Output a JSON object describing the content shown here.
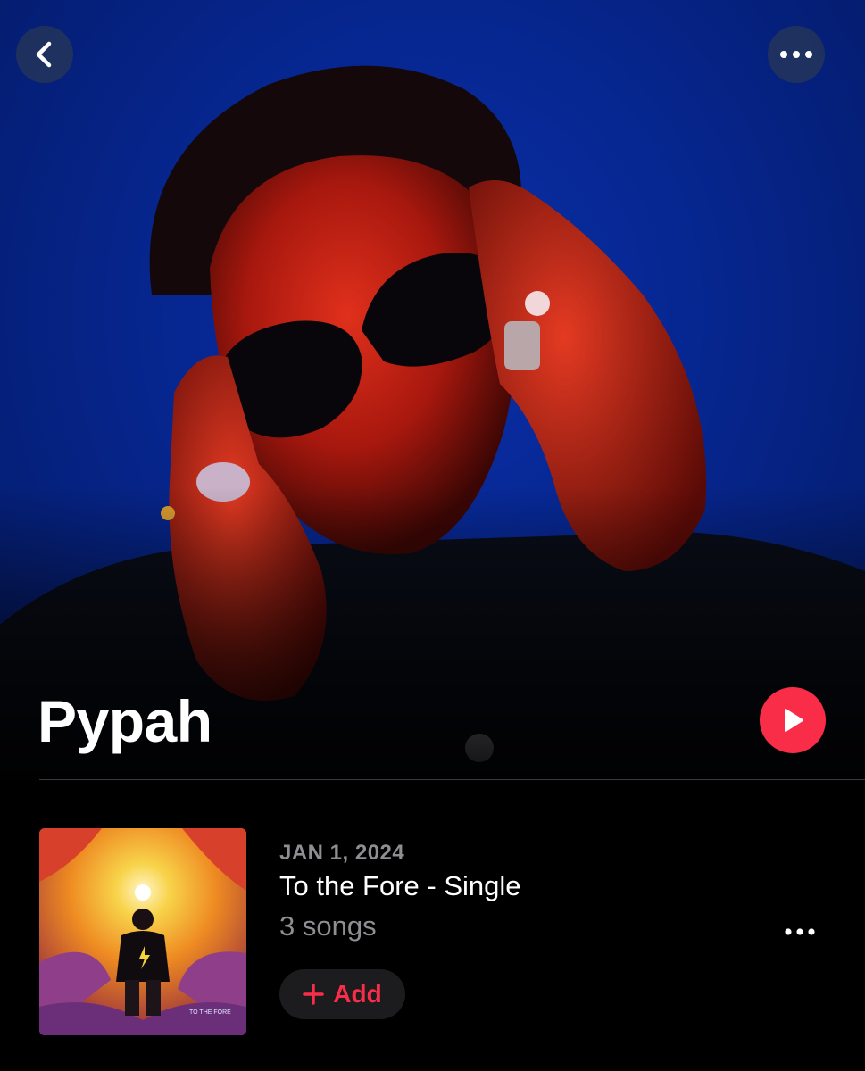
{
  "artist": {
    "name": "Pypah"
  },
  "icons": {
    "back": "chevron-left-icon",
    "more": "ellipsis-icon",
    "play": "play-icon",
    "add": "plus-icon"
  },
  "release": {
    "date": "JAN 1, 2024",
    "title": "To the Fore - Single",
    "song_count": "3 songs",
    "add_label": "Add",
    "cover_text": "TO THE FORE"
  },
  "colors": {
    "accent": "#fa2d48",
    "hero_background": "#06268f",
    "secondary_text": "#8e8e93"
  }
}
